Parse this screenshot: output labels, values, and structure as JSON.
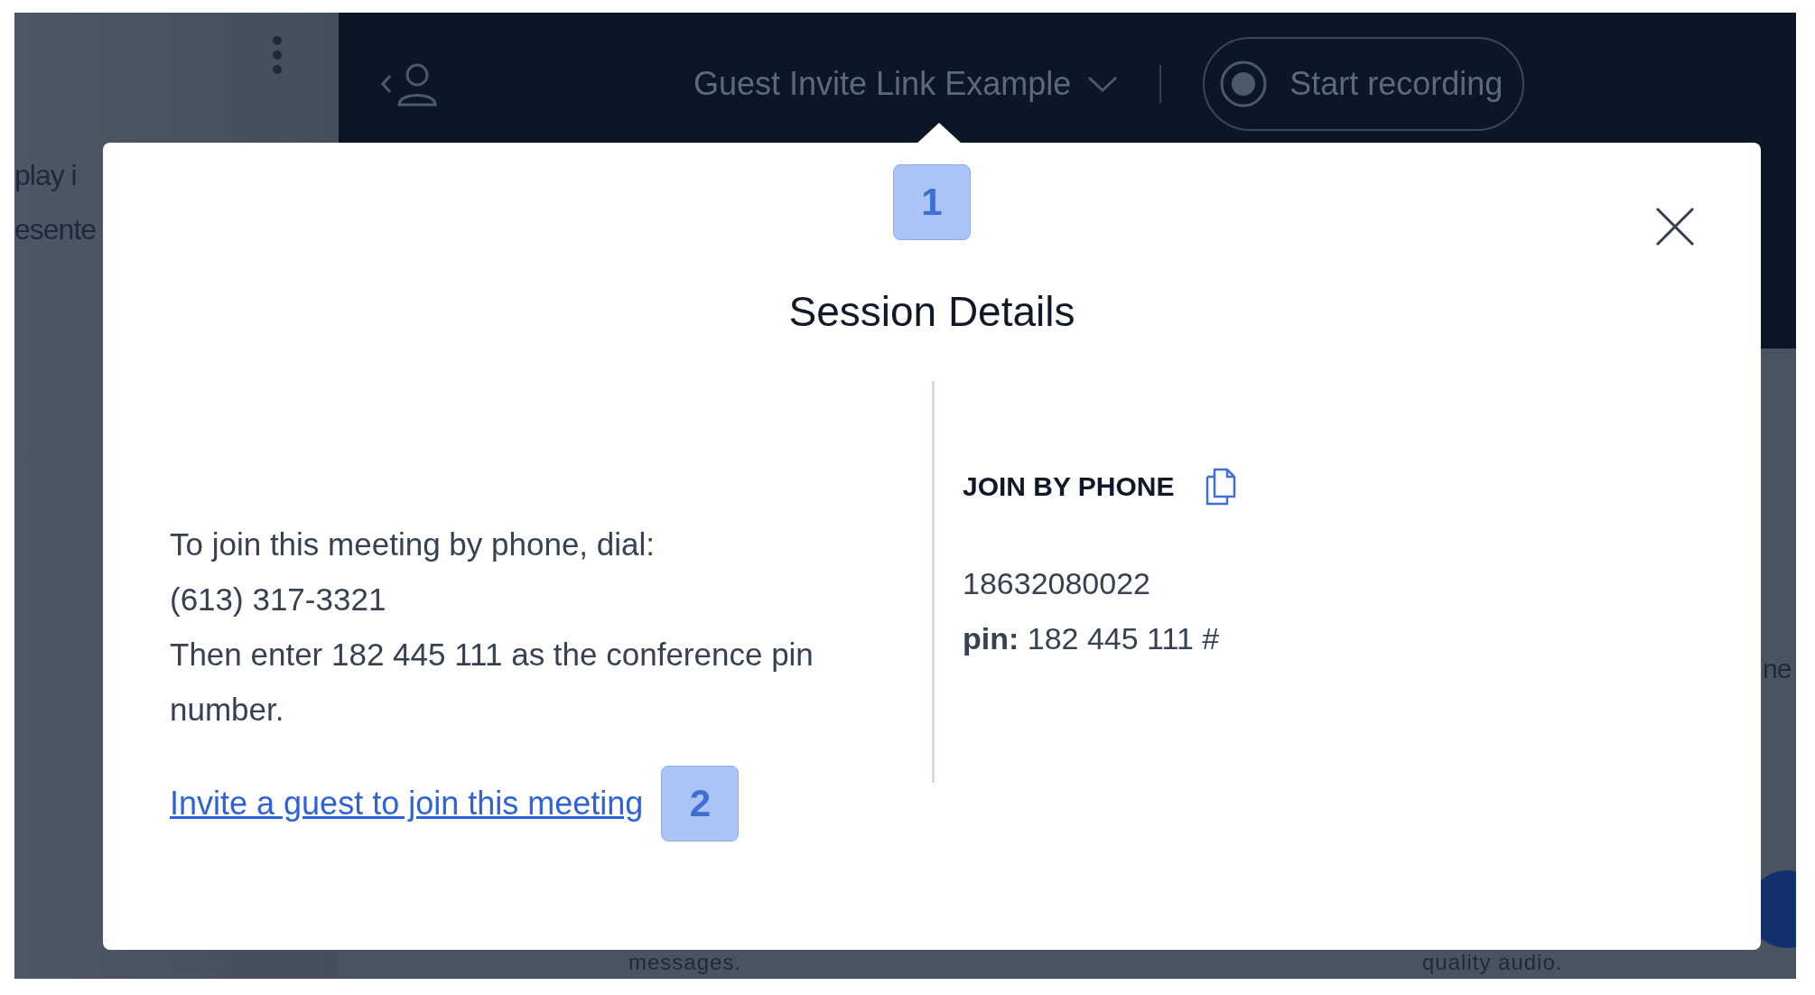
{
  "sidebar": {
    "texts": [
      "play i",
      "esente"
    ]
  },
  "header": {
    "title": "Guest Invite Link Example",
    "record_button": "Start recording"
  },
  "background_texts": [
    "ne",
    "messages.",
    "quality audio."
  ],
  "dialog": {
    "step_badges": [
      "1",
      "2"
    ],
    "title": "Session Details",
    "instructions": [
      "To join this meeting by phone, dial:",
      "(613) 317-3321",
      "Then enter 182 445 111 as the conference pin number."
    ],
    "invite_link": "Invite a guest to join this meeting",
    "join_by_phone": {
      "heading": "JOIN BY PHONE",
      "number": "18632080022",
      "pin": "**pin:** 182 445 111 #"
    }
  }
}
